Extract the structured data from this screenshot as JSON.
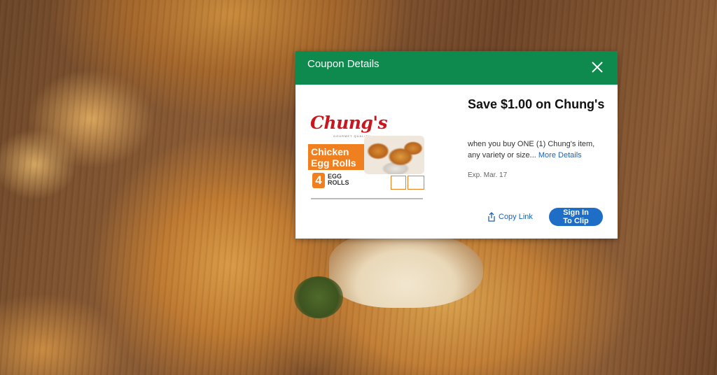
{
  "dialog": {
    "title": "Coupon Details",
    "close_icon": "close-icon"
  },
  "product": {
    "brand": "Chung's",
    "brand_sub": "GOURMET QUALITY",
    "name_line1": "Chicken",
    "name_line2": "Egg Rolls",
    "count": "4",
    "count_label": "EGG ROLLS"
  },
  "offer": {
    "headline": "Save $1.00 on Chung's",
    "description": "when you buy ONE (1) Chung's item, any variety or size...",
    "more_details": "More Details",
    "expiration": "Exp. Mar. 17"
  },
  "actions": {
    "copy_link": "Copy Link",
    "share_icon": "share-icon",
    "sign_in_line1": "Sign In",
    "sign_in_line2": "To Clip"
  },
  "colors": {
    "header_green": "#0f8a4e",
    "link_blue": "#1b61b5",
    "button_blue": "#1e6ec8",
    "brand_red": "#c8171e",
    "package_orange": "#f07f1f"
  }
}
